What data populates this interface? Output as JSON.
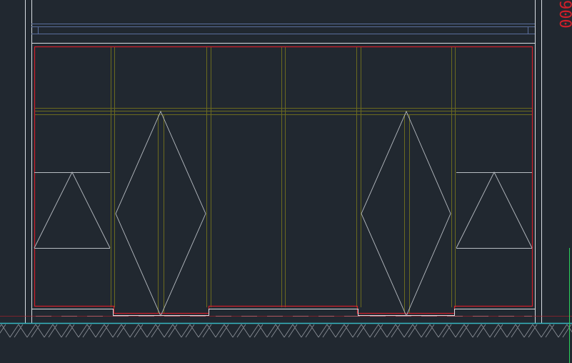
{
  "drawing": {
    "dimension_label": "900",
    "colors": {
      "background": "#212830",
      "frame": "#d8dde2",
      "red": "#d01f2a",
      "panel": "#6b6a1f",
      "opening": "#b7bcc2",
      "blue": "#5a6e9c",
      "ground": "#37b7c2",
      "hatch": "#8e949b",
      "green": "#2bd15c"
    }
  }
}
